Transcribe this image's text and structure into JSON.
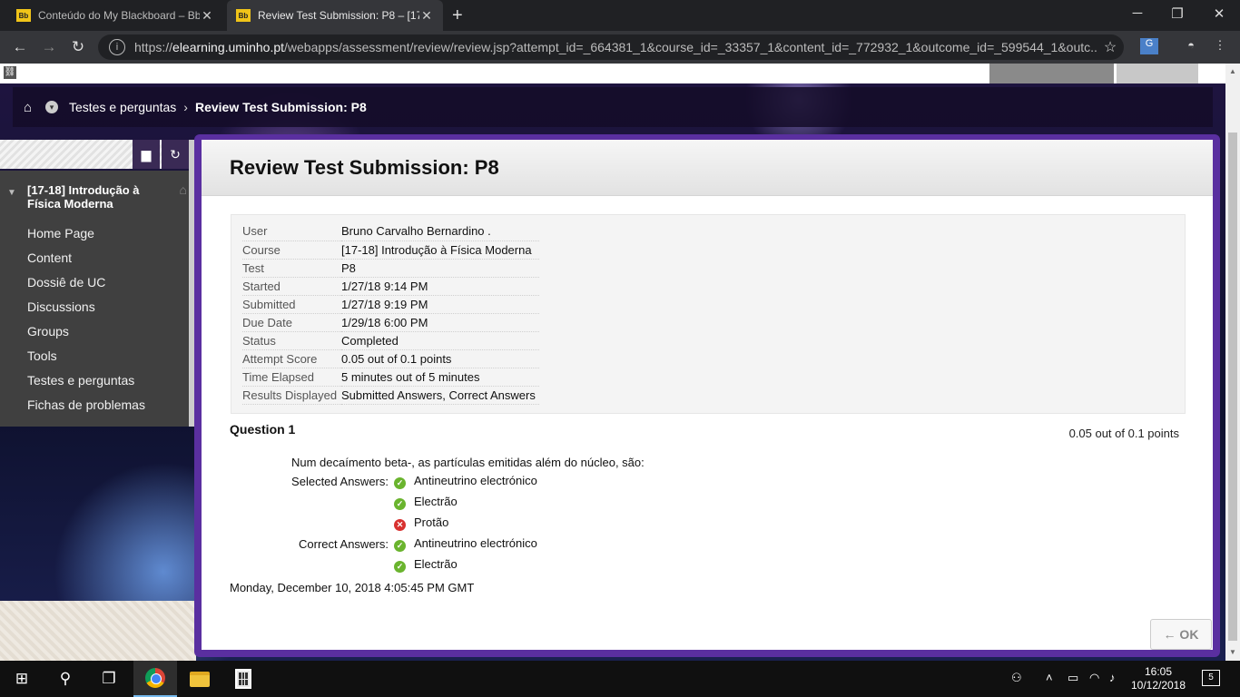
{
  "browser": {
    "tabs": [
      {
        "favicon": "Bb",
        "title": "Conteúdo do My Blackboard – Bb",
        "close": "✕"
      },
      {
        "favicon": "Bb",
        "title": "Review Test Submission: P8 – [17-",
        "close": "✕"
      }
    ],
    "new_tab": "+",
    "url_host": "elearning.uminho.pt",
    "url_prefix": "https://",
    "url_path": "/webapps/assessment/review/review.jsp?attempt_id=_664381_1&course_id=_33357_1&content_id=_772932_1&outcome_id=_599544_1&outc..."
  },
  "breadcrumb": {
    "items": [
      "Testes e perguntas",
      "Review Test Submission: P8"
    ],
    "separator": "›"
  },
  "sidebar": {
    "course_title": "[17-18] Introdução à Física Moderna",
    "items": [
      {
        "label": "Home Page"
      },
      {
        "label": "Content"
      },
      {
        "label": "Dossiê de UC"
      },
      {
        "label": "Discussions"
      },
      {
        "label": "Groups"
      },
      {
        "label": "Tools"
      },
      {
        "label": "Testes e perguntas"
      },
      {
        "label": "Fichas de problemas"
      }
    ]
  },
  "main": {
    "title": "Review Test Submission: P8",
    "summary": [
      {
        "key": "User",
        "value": "Bruno Carvalho Bernardino ."
      },
      {
        "key": "Course",
        "value": "[17-18] Introdução à Física Moderna"
      },
      {
        "key": "Test",
        "value": "P8"
      },
      {
        "key": "Started",
        "value": "1/27/18 9:14 PM"
      },
      {
        "key": "Submitted",
        "value": "1/27/18 9:19 PM"
      },
      {
        "key": "Due Date",
        "value": "1/29/18 6:00 PM"
      },
      {
        "key": "Status",
        "value": "Completed"
      },
      {
        "key": "Attempt Score",
        "value": "0.05 out of 0.1 points"
      },
      {
        "key": "Time Elapsed",
        "value": "5 minutes out of 5 minutes"
      },
      {
        "key": "Results Displayed",
        "value": "Submitted Answers, Correct Answers"
      }
    ],
    "question": {
      "title": "Question 1",
      "points": "0.05 out of 0.1 points",
      "text": "Num decaímento beta-, as partículas emitidas além do núcleo, são:",
      "selected_label": "Selected Answers:",
      "selected": [
        {
          "text": "Antineutrino electrónico",
          "correct": true
        },
        {
          "text": "Electrão",
          "correct": true
        },
        {
          "text": "Protão",
          "correct": false
        }
      ],
      "correct_label": "Correct Answers:",
      "correct": [
        {
          "text": "Antineutrino electrónico",
          "correct": true
        },
        {
          "text": "Electrão",
          "correct": true
        }
      ]
    },
    "timestamp": "Monday, December 10, 2018 4:05:45 PM GMT",
    "ok_label": "← OK"
  },
  "taskbar": {
    "time": "16:05",
    "date": "10/12/2018",
    "notifications": "5"
  },
  "colors": {
    "accent_frame": "#5a2fa0",
    "sidebar_bg": "#404040",
    "correct_icon": "#6ab42e",
    "incorrect_icon": "#d8312f"
  }
}
